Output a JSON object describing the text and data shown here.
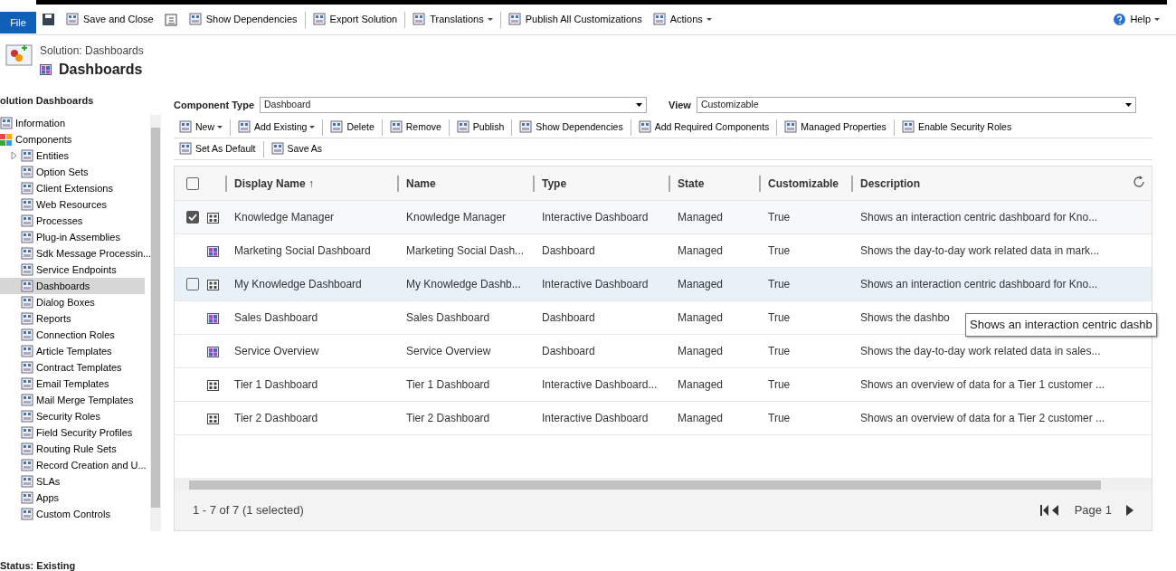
{
  "ribbon": {
    "file": "File",
    "items": [
      {
        "kind": "icon"
      },
      {
        "kind": "button",
        "label": "Save and Close"
      },
      {
        "kind": "icon"
      },
      {
        "kind": "button",
        "label": "Show Dependencies"
      },
      {
        "kind": "sep"
      },
      {
        "kind": "button",
        "label": "Export Solution"
      },
      {
        "kind": "sep"
      },
      {
        "kind": "menu",
        "label": "Translations"
      },
      {
        "kind": "sep"
      },
      {
        "kind": "button",
        "label": "Publish All Customizations"
      },
      {
        "kind": "menu",
        "label": "Actions"
      }
    ],
    "help": "Help"
  },
  "header": {
    "subtitle": "Solution: Dashboards",
    "title": "Dashboards"
  },
  "sidebar": {
    "title": "olution Dashboards",
    "items": [
      {
        "label": "Information",
        "selected": false,
        "kind": "leaf"
      },
      {
        "label": "Components",
        "selected": false,
        "kind": "group",
        "children": [
          {
            "label": "Entities",
            "selected": false,
            "kind": "folder"
          },
          {
            "label": "Option Sets",
            "selected": false,
            "kind": "leaf"
          },
          {
            "label": "Client Extensions",
            "selected": false,
            "kind": "leaf"
          },
          {
            "label": "Web Resources",
            "selected": false,
            "kind": "leaf"
          },
          {
            "label": "Processes",
            "selected": false,
            "kind": "leaf"
          },
          {
            "label": "Plug-in Assemblies",
            "selected": false,
            "kind": "leaf"
          },
          {
            "label": "Sdk Message Processin...",
            "selected": false,
            "kind": "leaf"
          },
          {
            "label": "Service Endpoints",
            "selected": false,
            "kind": "leaf"
          },
          {
            "label": "Dashboards",
            "selected": true,
            "kind": "leaf"
          },
          {
            "label": "Dialog Boxes",
            "selected": false,
            "kind": "leaf"
          },
          {
            "label": "Reports",
            "selected": false,
            "kind": "leaf"
          },
          {
            "label": "Connection Roles",
            "selected": false,
            "kind": "leaf"
          },
          {
            "label": "Article Templates",
            "selected": false,
            "kind": "leaf"
          },
          {
            "label": "Contract Templates",
            "selected": false,
            "kind": "leaf"
          },
          {
            "label": "Email Templates",
            "selected": false,
            "kind": "leaf"
          },
          {
            "label": "Mail Merge Templates",
            "selected": false,
            "kind": "leaf"
          },
          {
            "label": "Security Roles",
            "selected": false,
            "kind": "leaf"
          },
          {
            "label": "Field Security Profiles",
            "selected": false,
            "kind": "leaf"
          },
          {
            "label": "Routing Rule Sets",
            "selected": false,
            "kind": "leaf"
          },
          {
            "label": "Record Creation and U...",
            "selected": false,
            "kind": "leaf"
          },
          {
            "label": "SLAs",
            "selected": false,
            "kind": "leaf"
          },
          {
            "label": "Apps",
            "selected": false,
            "kind": "leaf"
          },
          {
            "label": "Custom Controls",
            "selected": false,
            "kind": "leaf"
          }
        ]
      }
    ]
  },
  "filters": [
    {
      "label": "Component Type",
      "value": "Dashboard"
    },
    {
      "label": "View",
      "value": "Customizable"
    }
  ],
  "toolbar": [
    [
      {
        "label": "New",
        "menu": true
      },
      {
        "label": "Add Existing",
        "menu": true
      },
      {
        "label": "Delete",
        "menu": false
      },
      {
        "label": "Remove",
        "menu": false
      },
      {
        "label": "Publish",
        "menu": false
      },
      {
        "label": "Show Dependencies",
        "menu": false
      },
      {
        "label": "Add Required Components",
        "menu": false
      },
      {
        "label": "Managed Properties",
        "menu": false
      },
      {
        "label": "Enable Security Roles",
        "menu": false
      }
    ],
    [
      {
        "label": "Set As Default",
        "menu": false
      },
      {
        "label": "Save As",
        "menu": false
      }
    ]
  ],
  "table": {
    "all_selected": false,
    "columns": [
      "Display Name ↑",
      "Name",
      "Type",
      "State",
      "Customizable",
      "Description"
    ],
    "rows": [
      {
        "kind": "interactive",
        "selected": true,
        "hovered": false,
        "cells": [
          "Knowledge Manager",
          "Knowledge Manager",
          "Interactive Dashboard",
          "Managed",
          "True",
          "Shows an interaction centric dashboard for Kno..."
        ]
      },
      {
        "kind": "classic",
        "selected": false,
        "hovered": false,
        "cells": [
          "Marketing Social Dashboard",
          "Marketing Social Dash...",
          "Dashboard",
          "Managed",
          "True",
          "Shows the day-to-day work related data in mark..."
        ]
      },
      {
        "kind": "interactive",
        "selected": false,
        "hovered": true,
        "cells": [
          "My Knowledge Dashboard",
          "My Knowledge Dashb...",
          "Interactive Dashboard",
          "Managed",
          "True",
          "Shows an interaction centric dashboard for Kno..."
        ]
      },
      {
        "kind": "classic",
        "selected": false,
        "hovered": false,
        "cells": [
          "Sales Dashboard",
          "Sales Dashboard",
          "Dashboard",
          "Managed",
          "True",
          "Shows the dashbo"
        ]
      },
      {
        "kind": "classic",
        "selected": false,
        "hovered": false,
        "cells": [
          "Service Overview",
          "Service Overview",
          "Dashboard",
          "Managed",
          "True",
          "Shows the day-to-day work related data in sales..."
        ]
      },
      {
        "kind": "interactive",
        "selected": false,
        "hovered": false,
        "cells": [
          "Tier 1 Dashboard",
          "Tier 1 Dashboard",
          "Interactive Dashboard...",
          "Managed",
          "True",
          "Shows an overview of data for a Tier 1 customer ..."
        ]
      },
      {
        "kind": "interactive",
        "selected": false,
        "hovered": false,
        "cells": [
          "Tier 2 Dashboard",
          "Tier 2 Dashboard",
          "Interactive Dashboard",
          "Managed",
          "True",
          "Shows an overview of data for a Tier 2 customer ..."
        ]
      }
    ],
    "tooltip": "Shows an interaction centric dashb"
  },
  "footer": {
    "count": "1 - 7 of 7 (1 selected)",
    "page": "Page 1"
  },
  "status": "Status: Existing"
}
